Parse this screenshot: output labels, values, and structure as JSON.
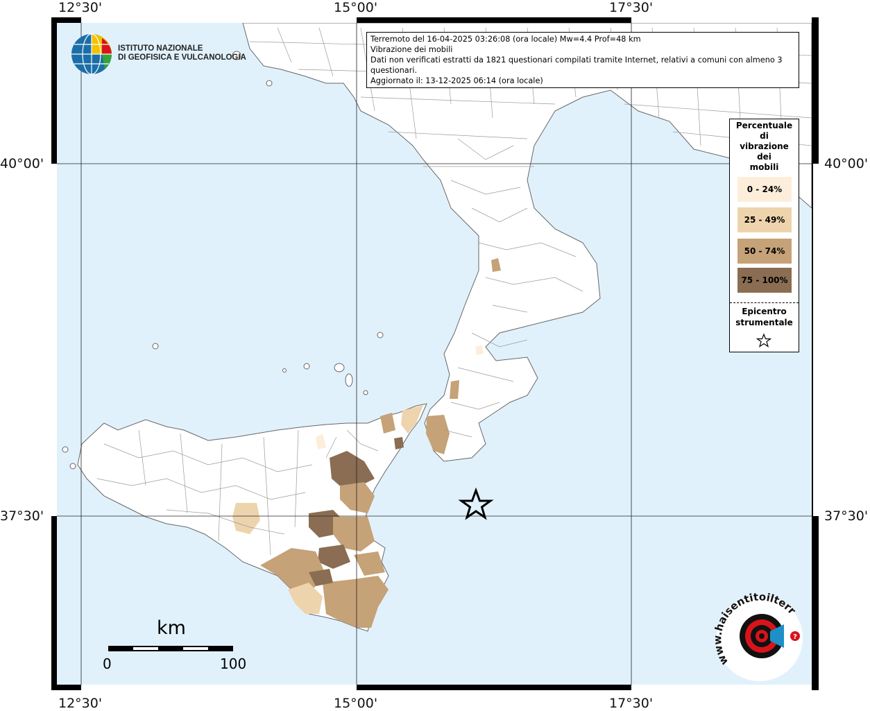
{
  "map": {
    "lon_ticks": [
      "12°30'",
      "15°00'",
      "17°30'"
    ],
    "lat_ticks": [
      "40°00'",
      "37°30'"
    ],
    "colors": {
      "sea": "#e1f1fc",
      "land": "#ffffff",
      "border": "#8a8a8a",
      "frame": "#000000"
    }
  },
  "info": {
    "line1": "Terremoto del 16-04-2025 03:26:08 (ora locale) Mw=4.4 Prof=48 km",
    "line2": "Vibrazione dei mobili",
    "line3": "Dati non verificati estratti da 1821 questionari compilati tramite Internet, relativi a comuni con almeno 3 questionari.",
    "line4": "Aggiornato il: 13-12-2025 06:14 (ora locale)"
  },
  "legend": {
    "title_lines": [
      "Percentuale",
      "di",
      "vibrazione",
      "dei",
      "mobili"
    ],
    "classes": [
      {
        "label": "0 - 24%",
        "color": "#fdeedb"
      },
      {
        "label": "25 - 49%",
        "color": "#edd4ad"
      },
      {
        "label": "50 - 74%",
        "color": "#c5a277"
      },
      {
        "label": "75 - 100%",
        "color": "#8a6d52"
      }
    ],
    "epicenter_line1": "Epicentro",
    "epicenter_line2": "strumentale"
  },
  "ingv_logo": {
    "line1": "ISTITUTO NAZIONALE",
    "line2": "DI GEOFISICA E VULCANOLOGIA"
  },
  "scale": {
    "unit": "km",
    "min_label": "0",
    "max_label": "100"
  },
  "hs_logo": {
    "text": "www.haisentitoilterremoto.it",
    "accent": "#d7141a"
  }
}
